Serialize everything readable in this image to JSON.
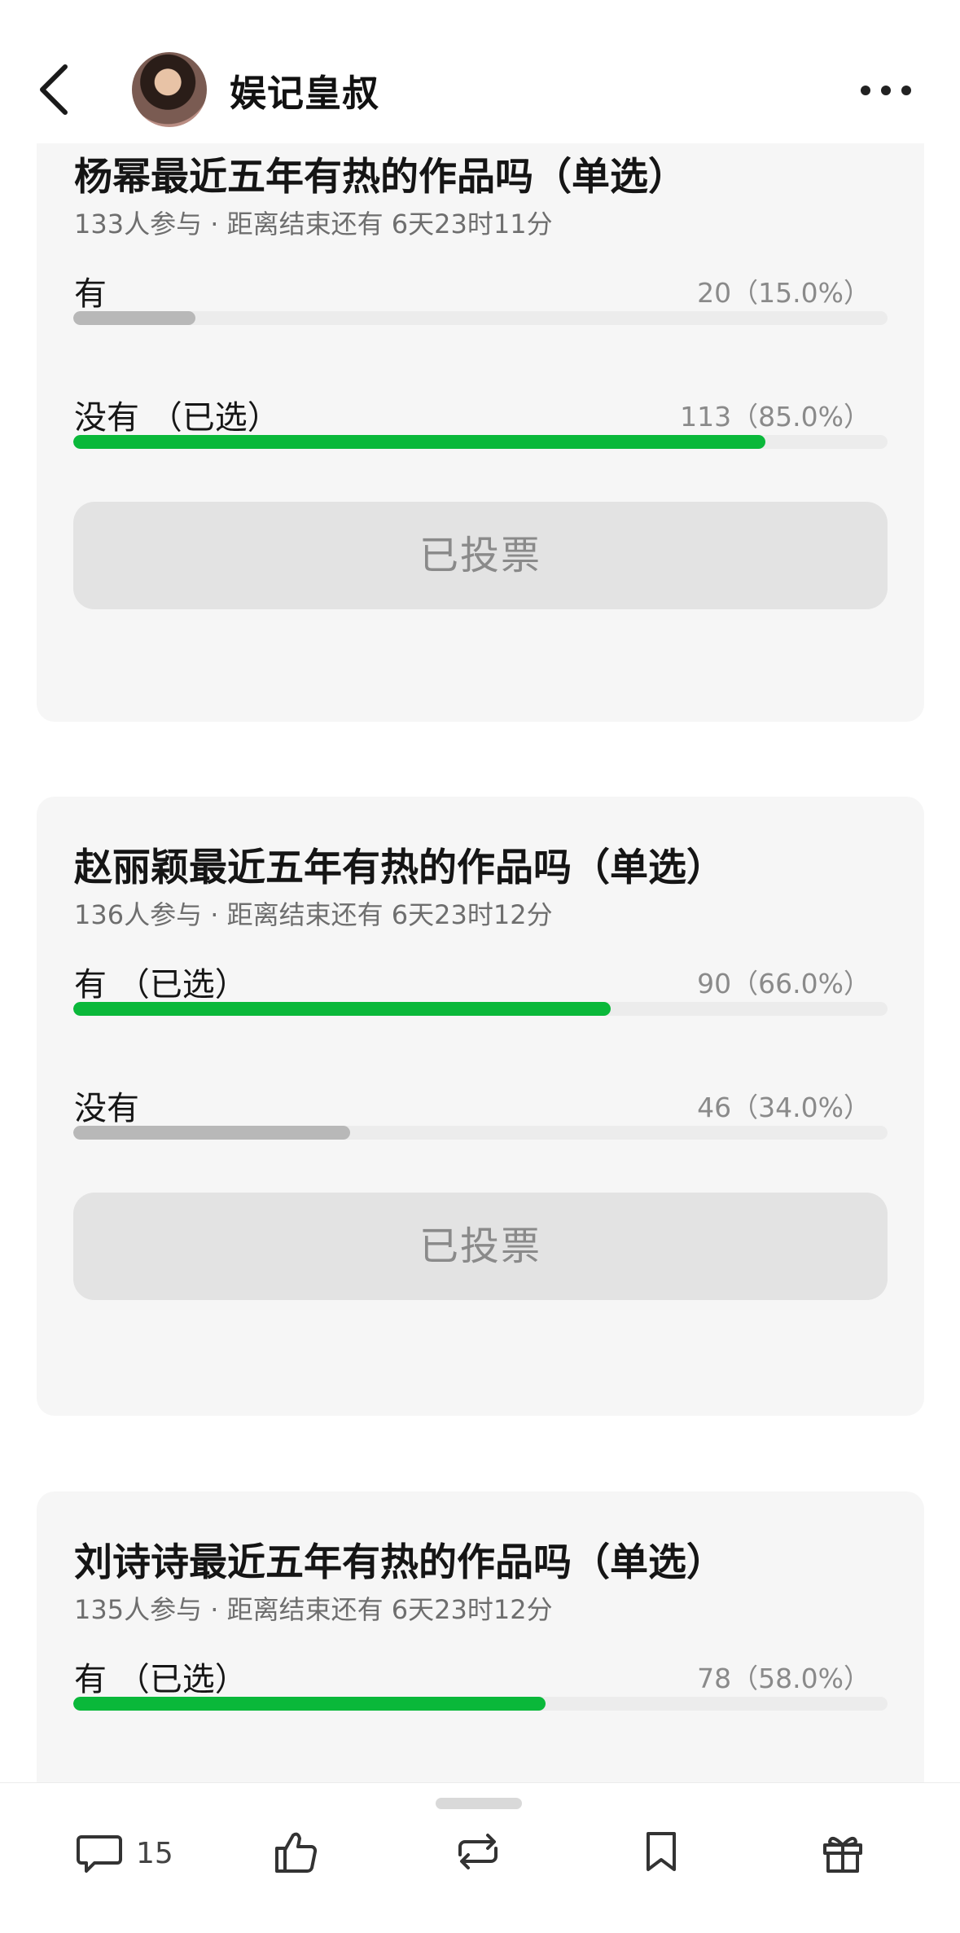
{
  "header": {
    "author": "娱记皇叔"
  },
  "polls": [
    {
      "title": "杨幂最近五年有热的作品吗（单选）",
      "meta": "133人参与 · 距离结束还有 6天23时11分",
      "options": [
        {
          "label": "有",
          "count": "20（15.0%）",
          "percent": 15.0,
          "selected": false
        },
        {
          "label": "没有 （已选）",
          "count": "113（85.0%）",
          "percent": 85.0,
          "selected": true
        }
      ],
      "button": "已投票"
    },
    {
      "title": "赵丽颖最近五年有热的作品吗（单选）",
      "meta": "136人参与 · 距离结束还有 6天23时12分",
      "options": [
        {
          "label": "有 （已选）",
          "count": "90（66.0%）",
          "percent": 66.0,
          "selected": true
        },
        {
          "label": "没有",
          "count": "46（34.0%）",
          "percent": 34.0,
          "selected": false
        }
      ],
      "button": "已投票"
    },
    {
      "title": "刘诗诗最近五年有热的作品吗（单选）",
      "meta": "135人参与 · 距离结束还有 6天23时12分",
      "options": [
        {
          "label": "有 （已选）",
          "count": "78（58.0%）",
          "percent": 58.0,
          "selected": true
        }
      ]
    }
  ],
  "bottom_bar": {
    "comment_count": "15"
  },
  "colors": {
    "selected_fill": "#0ab83a",
    "unselected_fill": "#b8b8b8",
    "card_bg": "#f6f6f6"
  },
  "icons": [
    "back-icon",
    "more-icon",
    "comment-icon",
    "like-icon",
    "repost-icon",
    "bookmark-icon",
    "gift-icon"
  ]
}
